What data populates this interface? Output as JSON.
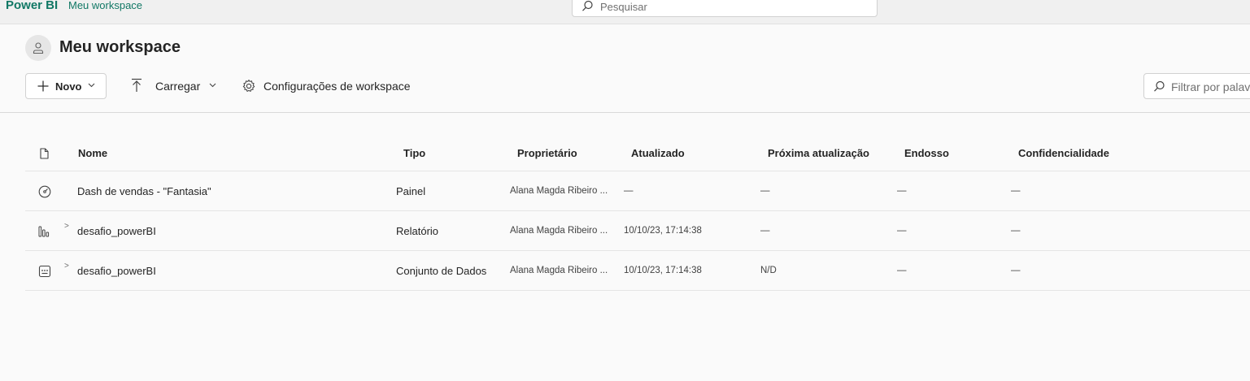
{
  "topbar": {
    "brand": "Power BI",
    "breadcrumb": "Meu workspace",
    "search_placeholder": "Pesquisar"
  },
  "header": {
    "title": "Meu workspace"
  },
  "toolbar": {
    "new_label": "Novo",
    "upload_label": "Carregar",
    "settings_label": "Configurações de workspace",
    "filter_placeholder": "Filtrar por palavra-chave"
  },
  "table": {
    "columns": {
      "name": "Nome",
      "type": "Tipo",
      "owner": "Proprietário",
      "updated": "Atualizado",
      "next_refresh": "Próxima atualização",
      "endorsement": "Endosso",
      "sensitivity": "Confidencialidade"
    },
    "rows": [
      {
        "icon": "dashboard-icon",
        "shared_mark": "",
        "name": "Dash de vendas - \"Fantasia\"",
        "type": "Painel",
        "owner": "Alana Magda Ribeiro ...",
        "updated": "—",
        "next_refresh": "—",
        "endorsement": "—",
        "sensitivity": "—"
      },
      {
        "icon": "report-icon",
        "shared_mark": "˃",
        "name": "desafio_powerBI",
        "type": "Relatório",
        "owner": "Alana Magda Ribeiro ...",
        "updated": "10/10/23, 17:14:38",
        "next_refresh": "—",
        "endorsement": "—",
        "sensitivity": "—"
      },
      {
        "icon": "dataset-icon",
        "shared_mark": "˃",
        "name": "desafio_powerBI",
        "type": "Conjunto de Dados",
        "owner": "Alana Magda Ribeiro ...",
        "updated": "10/10/23, 17:14:38",
        "next_refresh": "N/D",
        "endorsement": "—",
        "sensitivity": "—"
      }
    ]
  },
  "colors": {
    "brand": "#117865",
    "background": "#fafafa"
  }
}
